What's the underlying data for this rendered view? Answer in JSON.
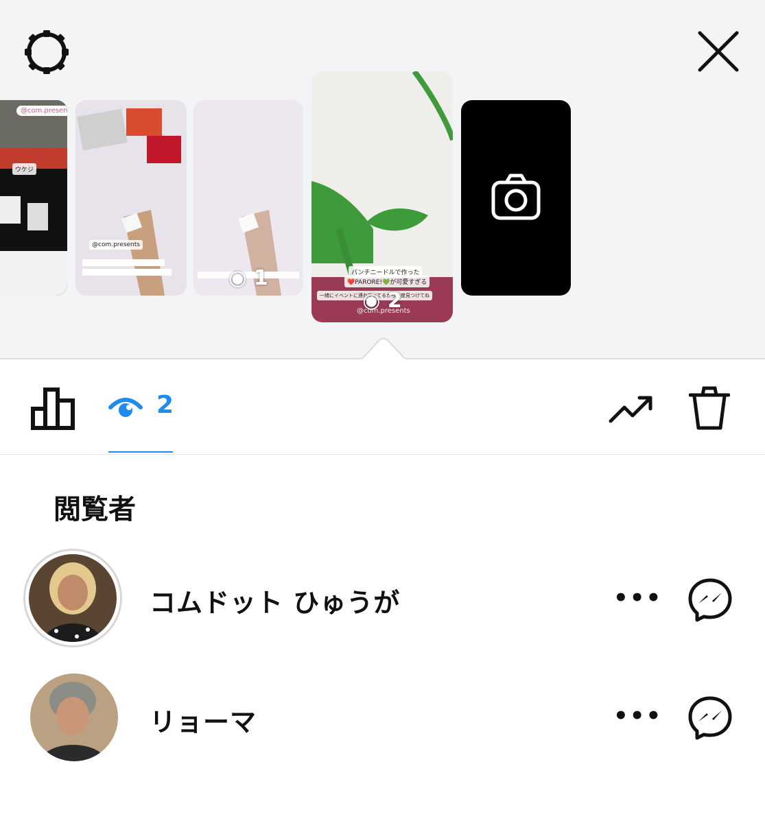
{
  "header": {
    "settings_icon": "gear-icon",
    "close_icon": "close-icon"
  },
  "stories": [
    {
      "label": "story-1",
      "views": "",
      "tag_text": "@com.presents",
      "caption": "ウケジ"
    },
    {
      "label": "story-2",
      "views": "",
      "caption": "@com.presents"
    },
    {
      "label": "story-3",
      "views": "1"
    },
    {
      "label": "story-4",
      "views": "2",
      "caption_top": "パンチニードルで作った",
      "caption_mid": "❤️PARORE!💚が可愛すぎる",
      "caption_bottom": "一緒にイベントに連れてってるから今度見つけてね",
      "caption_handle": "@com.presents"
    }
  ],
  "camera_icon": "camera-icon",
  "tabs": {
    "insights_icon": "bar-chart-icon",
    "views_icon": "eye-icon",
    "views_count": "2",
    "trend_icon": "trending-up-icon",
    "trash_icon": "trash-icon"
  },
  "viewers_title": "閲覧者",
  "viewers": [
    {
      "name": "コムドット ひゅうが",
      "more": "•••",
      "message_icon": "messenger-icon"
    },
    {
      "name": "リョーマ",
      "more": "•••",
      "message_icon": "messenger-icon"
    }
  ],
  "colors": {
    "accent": "#1d8cf0",
    "top_background": "#f3f4f6"
  }
}
